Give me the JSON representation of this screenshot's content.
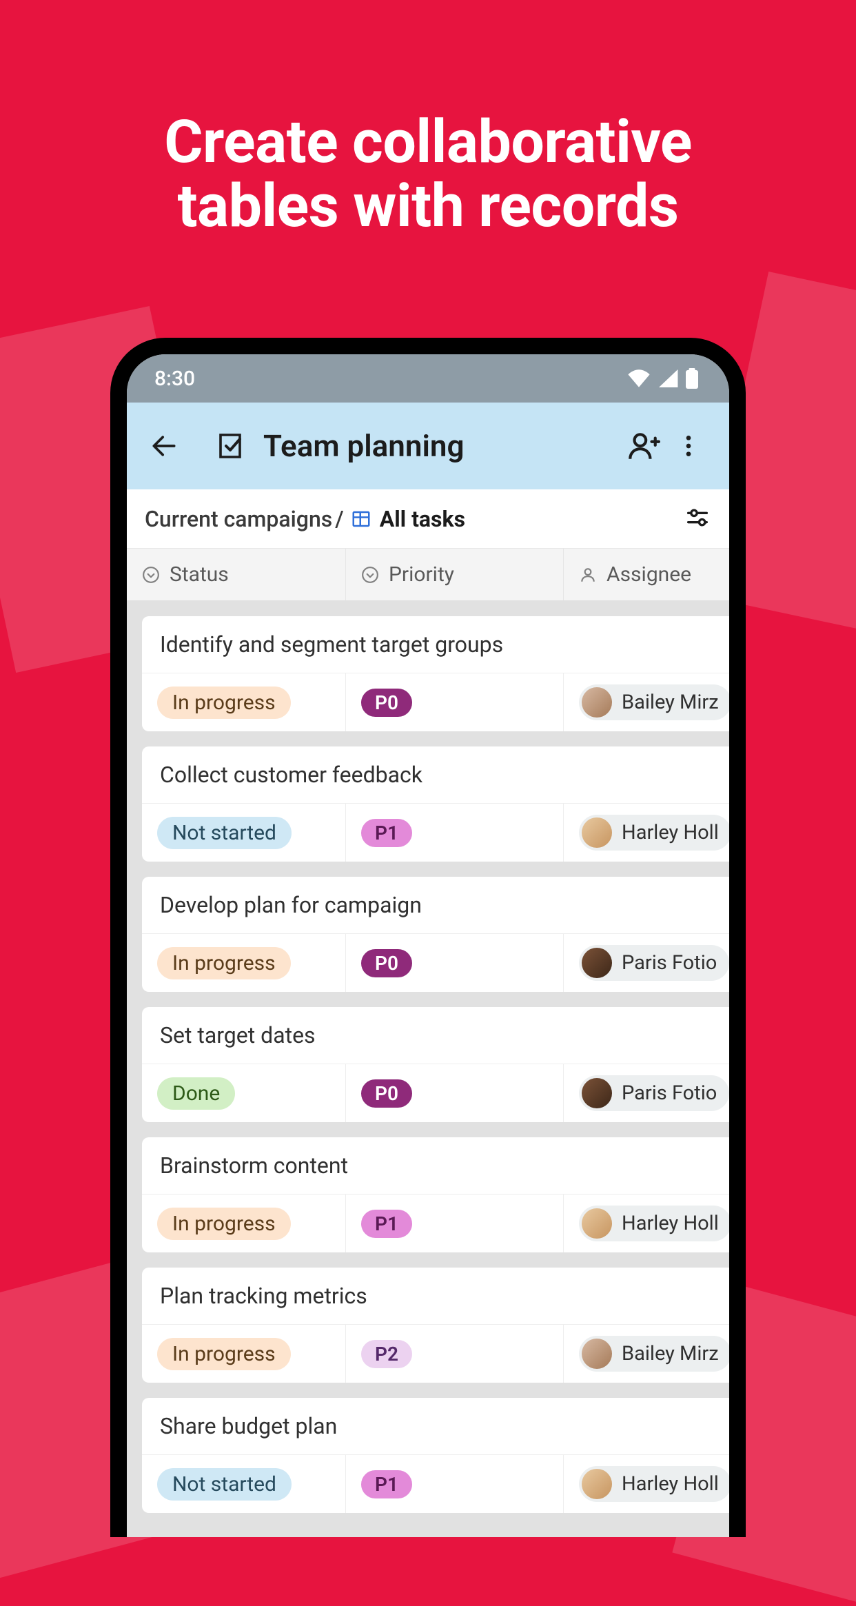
{
  "promo": {
    "headline_line1": "Create collaborative",
    "headline_line2": "tables with records"
  },
  "statusbar": {
    "time": "8:30"
  },
  "appbar": {
    "title": "Team planning"
  },
  "breadcrumb": {
    "parent": "Current campaigns",
    "view": "All tasks"
  },
  "columns": {
    "status": "Status",
    "priority": "Priority",
    "assignee": "Assignee"
  },
  "status_labels": {
    "in_progress": "In progress",
    "not_started": "Not started",
    "done": "Done"
  },
  "priority_labels": {
    "p0": "P0",
    "p1": "P1",
    "p2": "P2"
  },
  "assignees": {
    "bailey": "Bailey Mirz",
    "harley": "Harley Holl",
    "paris": "Paris Fotio"
  },
  "tasks": [
    {
      "title": "Identify and segment target groups",
      "status": "in_progress",
      "priority": "p0",
      "assignee": "bailey",
      "avatar": "c1"
    },
    {
      "title": "Collect customer feedback",
      "status": "not_started",
      "priority": "p1",
      "assignee": "harley",
      "avatar": "c2"
    },
    {
      "title": "Develop plan for campaign",
      "status": "in_progress",
      "priority": "p0",
      "assignee": "paris",
      "avatar": "c3"
    },
    {
      "title": "Set target dates",
      "status": "done",
      "priority": "p0",
      "assignee": "paris",
      "avatar": "c3"
    },
    {
      "title": "Brainstorm content",
      "status": "in_progress",
      "priority": "p1",
      "assignee": "harley",
      "avatar": "c2"
    },
    {
      "title": "Plan tracking metrics",
      "status": "in_progress",
      "priority": "p2",
      "assignee": "bailey",
      "avatar": "c1"
    },
    {
      "title": "Share budget plan",
      "status": "not_started",
      "priority": "p1",
      "assignee": "harley",
      "avatar": "c2"
    }
  ]
}
